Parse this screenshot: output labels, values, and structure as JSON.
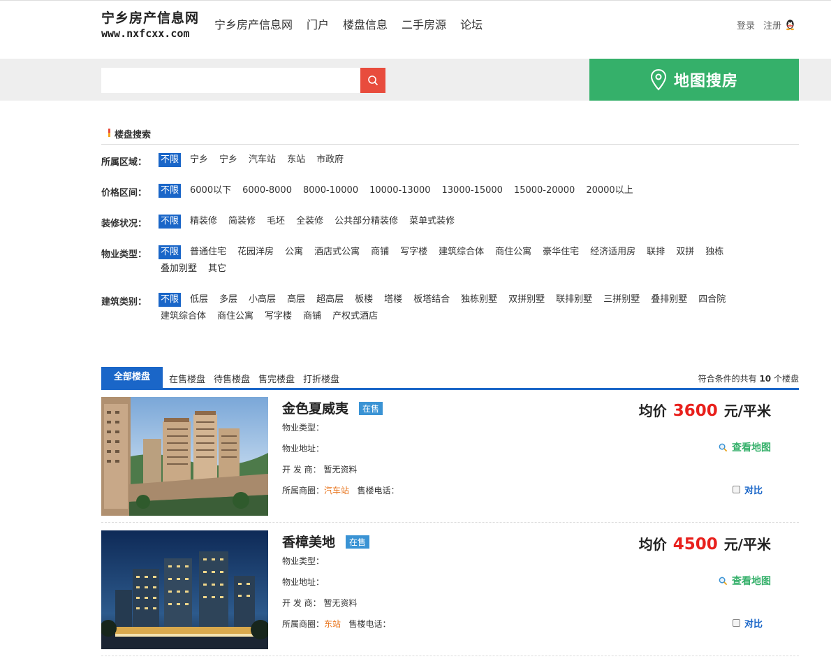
{
  "header": {
    "logo_cn": "宁乡房产信息网",
    "logo_url": "www.nxfcxx.com",
    "nav": [
      "宁乡房产信息网",
      "门户",
      "楼盘信息",
      "二手房源",
      "论坛"
    ],
    "login": "登录",
    "register": "注册",
    "qq_icon": "qq-penguin-icon"
  },
  "search": {
    "placeholder": "",
    "map_search_label": "地图搜房",
    "accent": "#e84c3d",
    "map_color": "#35b06a"
  },
  "section": {
    "title": "楼盘搜索"
  },
  "filters": [
    {
      "label": "所属区域：",
      "options": [
        "不限",
        "宁乡",
        "宁乡",
        "汽车站",
        "东站",
        "市政府"
      ]
    },
    {
      "label": "价格区间：",
      "options": [
        "不限",
        "6000以下",
        "6000-8000",
        "8000-10000",
        "10000-13000",
        "13000-15000",
        "15000-20000",
        "20000以上"
      ]
    },
    {
      "label": "装修状况：",
      "options": [
        "不限",
        "精装修",
        "简装修",
        "毛坯",
        "全装修",
        "公共部分精装修",
        "菜单式装修"
      ]
    },
    {
      "label": "物业类型：",
      "options": [
        "不限",
        "普通住宅",
        "花园洋房",
        "公寓",
        "酒店式公寓",
        "商铺",
        "写字楼",
        "建筑综合体",
        "商住公寓",
        "豪华住宅",
        "经济适用房",
        "联排",
        "双拼",
        "独栋",
        "叠加别墅",
        "其它"
      ]
    },
    {
      "label": "建筑类别：",
      "options": [
        "不限",
        "低层",
        "多层",
        "小高层",
        "高层",
        "超高层",
        "板楼",
        "塔楼",
        "板塔结合",
        "独栋别墅",
        "双拼别墅",
        "联排别墅",
        "三拼别墅",
        "叠排别墅",
        "四合院",
        "建筑综合体",
        "商住公寓",
        "写字楼",
        "商铺",
        "产权式酒店"
      ]
    }
  ],
  "tabs": {
    "items": [
      "全部楼盘",
      "在售楼盘",
      "待售楼盘",
      "售完楼盘",
      "打折楼盘"
    ],
    "count_prefix": "符合条件的共有",
    "count": "10",
    "count_suffix": "个楼盘"
  },
  "listings": [
    {
      "name": "金色夏威夷",
      "status": "在售",
      "property_type_label": "物业类型：",
      "address_label": "物业地址：",
      "developer_label": "开 发 商：",
      "developer": "暂无资料",
      "area_label": "所属商圈：",
      "area": "汽车站",
      "phone_label": "售楼电话：",
      "price_prefix": "均价",
      "price": "3600",
      "price_unit": "元/平米",
      "map_link": "查看地图",
      "compare": "对比"
    },
    {
      "name": "香樟美地",
      "status": "在售",
      "property_type_label": "物业类型：",
      "address_label": "物业地址：",
      "developer_label": "开 发 商：",
      "developer": "暂无资料",
      "area_label": "所属商圈：",
      "area": "东站",
      "phone_label": "售楼电话：",
      "price_prefix": "均价",
      "price": "4500",
      "price_unit": "元/平米",
      "map_link": "查看地图",
      "compare": "对比"
    }
  ]
}
